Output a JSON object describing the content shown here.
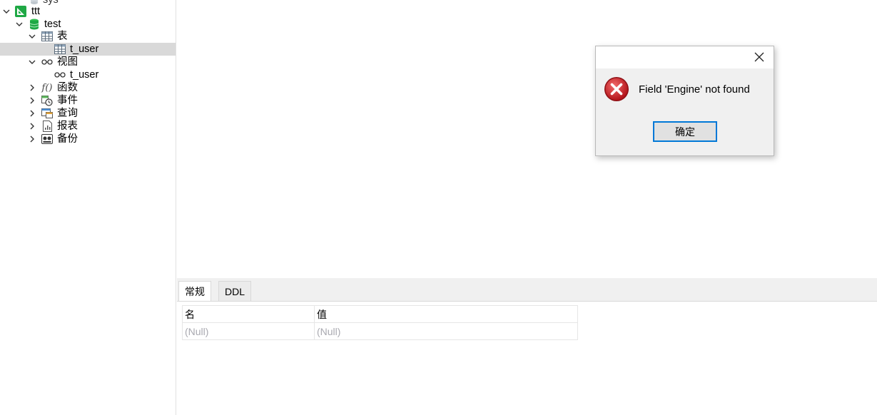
{
  "tree": {
    "sys_label": "sys",
    "connection_label": "ttt",
    "database_label": "test",
    "tables_label": "表",
    "table_item_label": "t_user",
    "views_label": "视图",
    "view_item_label": "t_user",
    "functions_label": "函数",
    "events_label": "事件",
    "queries_label": "查询",
    "reports_label": "报表",
    "backups_label": "备份"
  },
  "tabs": {
    "general": "常规",
    "ddl": "DDL"
  },
  "props": {
    "col_name": "名",
    "col_value": "值",
    "rows": [
      {
        "name": "(Null)",
        "value": "(Null)"
      }
    ]
  },
  "dialog": {
    "message": "Field 'Engine' not found",
    "ok_label": "确定",
    "icon": "error-icon"
  },
  "colors": {
    "accent": "#0078d7",
    "selected_row": "#d9d9d9",
    "error_red": "#d9262b",
    "connection_green": "#1fa845"
  }
}
